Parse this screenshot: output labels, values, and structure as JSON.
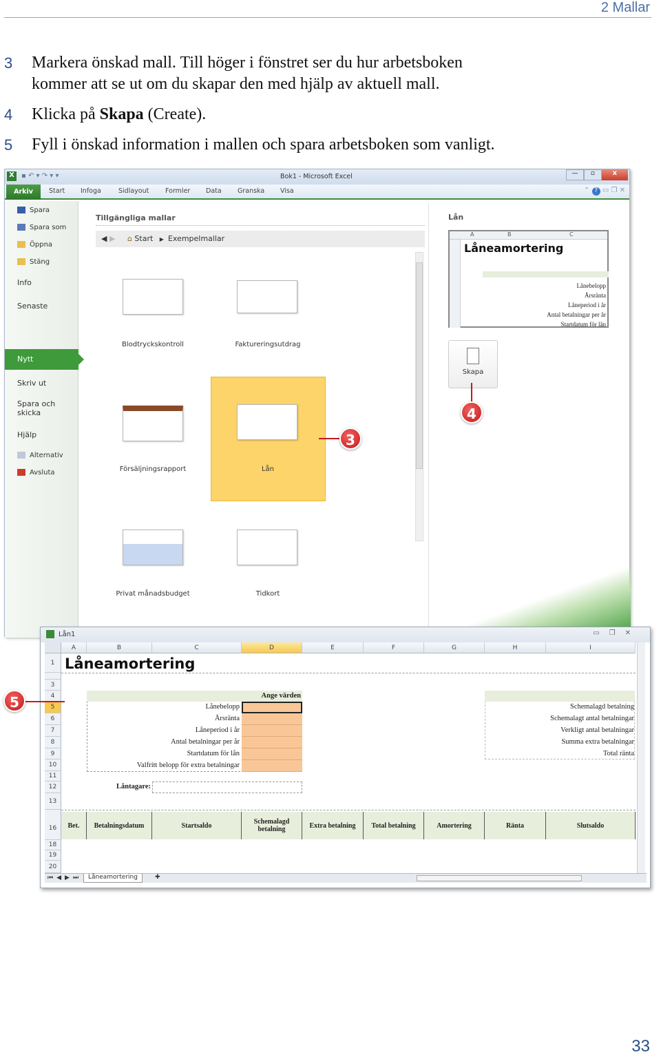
{
  "header": {
    "chapter": "2  Mallar",
    "page_number": "33"
  },
  "steps": [
    {
      "num": "3",
      "text": "Markera önskad mall. Till höger i fönstret ser du hur arbetsboken kommer att se ut om du skapar den med hjälp av aktuell mall.",
      "line1": "Markera önskad mall. Till höger i fönstret ser du hur arbetsboken",
      "line2": "kommer att se ut om du skapar den med hjälp av aktuell mall."
    },
    {
      "num": "4",
      "pre": "Klicka på ",
      "bold": "Skapa",
      "post": " (Create)."
    },
    {
      "num": "5",
      "text": "Fyll i önskad information i mallen och spara arbetsboken som vanligt."
    }
  ],
  "excel": {
    "title": "Bok1  -  Microsoft Excel",
    "tabs": [
      "Arkiv",
      "Start",
      "Infoga",
      "Sidlayout",
      "Formler",
      "Data",
      "Granska",
      "Visa"
    ],
    "sidebar": [
      "Spara",
      "Spara som",
      "Öppna",
      "Stäng",
      "Info",
      "Senaste",
      "Nytt",
      "Skriv ut",
      "Spara och skicka",
      "Hjälp",
      "Alternativ",
      "Avsluta"
    ],
    "section_title": "Tillgängliga mallar",
    "breadcrumb": {
      "home": "Start",
      "current": "Exempelmallar"
    },
    "templates": [
      "Blodtryckskontroll",
      "Faktureringsutdrag",
      "Försäljningsrapport",
      "Lån",
      "Privat månadsbudget",
      "Tidkort"
    ],
    "selected_template": "Lån",
    "preview": {
      "title": "Lån",
      "sheet_title": "Låneamortering",
      "cols": [
        "A",
        "B",
        "C"
      ],
      "rows": [
        "1",
        "3",
        "4",
        "5",
        "6",
        "7",
        "8",
        "9"
      ],
      "labels": [
        "Lånebelopp",
        "Årsränta",
        "Låneperiod i år",
        "Antal betalningar per år",
        "Startdatum för lån"
      ]
    },
    "create_label": "Skapa"
  },
  "callouts": [
    "3",
    "4",
    "5"
  ],
  "sheet": {
    "window_title": "Lån1",
    "columns": [
      "A",
      "B",
      "C",
      "D",
      "E",
      "F",
      "G",
      "H",
      "I"
    ],
    "rows": [
      "1",
      "3",
      "4",
      "5",
      "6",
      "7",
      "8",
      "9",
      "10",
      "11",
      "12",
      "13",
      "16",
      "18",
      "19",
      "20"
    ],
    "title": "Låneamortering",
    "input_header": "Ange värden",
    "input_labels": [
      "Lånebelopp",
      "Årsränta",
      "Låneperiod i år",
      "Antal betalningar per år",
      "Startdatum för lån",
      "Valfritt belopp för extra betalningar"
    ],
    "borrower_label": "Låntagare:",
    "summary_labels": [
      "Schemalagd betalning",
      "Schemalagt antal betalningar",
      "Verkligt antal betalningar",
      "Summa extra betalningar",
      "Total ränta"
    ],
    "table_headers": [
      "Bet.",
      "Betalningsdatum",
      "Startsaldo",
      "Schemalagd betalning",
      "Extra betalning",
      "Total betalning",
      "Amortering",
      "Ränta",
      "Slutsaldo"
    ],
    "sheet_tab": "Låneamortering"
  }
}
